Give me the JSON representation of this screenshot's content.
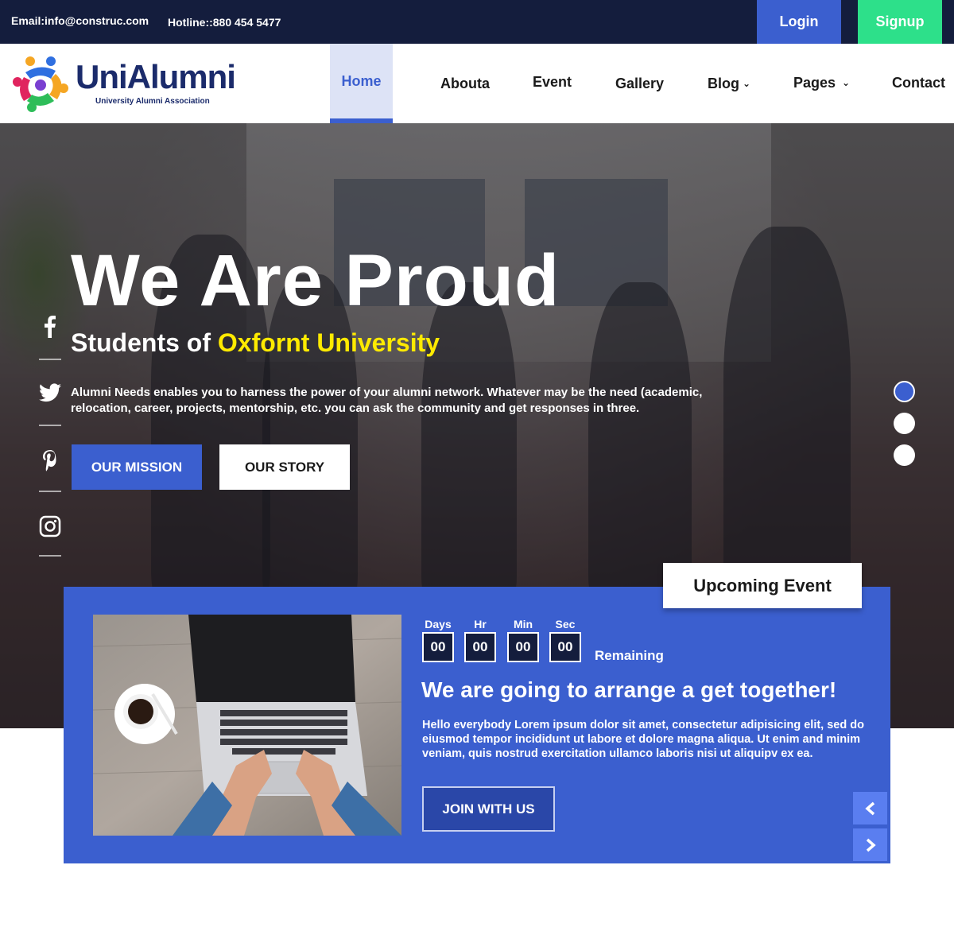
{
  "topbar": {
    "email": "Email:info@construc.com",
    "hotline": "Hotline::880 454 5477",
    "login_label": "Login",
    "signup_label": "Signup"
  },
  "brand": {
    "name_uni": "Uni",
    "name_alumni": "Alumni",
    "tagline": "University Alumni Association"
  },
  "nav": {
    "items": [
      {
        "label": "Home",
        "active": true
      },
      {
        "label": "Abouta"
      },
      {
        "label": "Event"
      },
      {
        "label": "Gallery"
      },
      {
        "label": "Blog",
        "dropdown": true
      },
      {
        "label": "Pages",
        "dropdown": true
      },
      {
        "label": "Contact"
      }
    ]
  },
  "hero": {
    "title": "We Are Proud",
    "subtitle_prefix": "Students of ",
    "subtitle_highlight": "Oxfornt University",
    "description": "Alumni Needs enables you to harness the power of your alumni network. Whatever may be the need (academic, relocation, career, projects, mentorship, etc. you can ask the community and get responses in three.",
    "mission_label": "OUR MISSION",
    "story_label": "OUR STORY",
    "social_icons": [
      "facebook-icon",
      "twitter-icon",
      "pinterest-icon",
      "instagram-icon"
    ],
    "slider_dots": 3,
    "active_dot": 0
  },
  "event": {
    "tab_label": "Upcoming Event",
    "countdown": {
      "labels": [
        "Days",
        "Hr",
        "Min",
        "Sec"
      ],
      "values": [
        "00",
        "00",
        "00",
        "00"
      ],
      "remaining_label": "Remaining"
    },
    "title": "We are going to arrange a get together!",
    "description": "Hello everybody Lorem ipsum dolor sit amet, consectetur adipisicing elit, sed do eiusmod tempor incididunt ut labore et dolore magna aliqua. Ut enim and minim veniam, quis nostrud exercitation ullamco laboris nisi ut aliquipv ex ea.",
    "join_label": "JOIN WITH US"
  },
  "colors": {
    "topbar_bg": "#141d3d",
    "accent": "#3b5fcf",
    "signup": "#2de08a",
    "highlight": "#ffea00"
  }
}
